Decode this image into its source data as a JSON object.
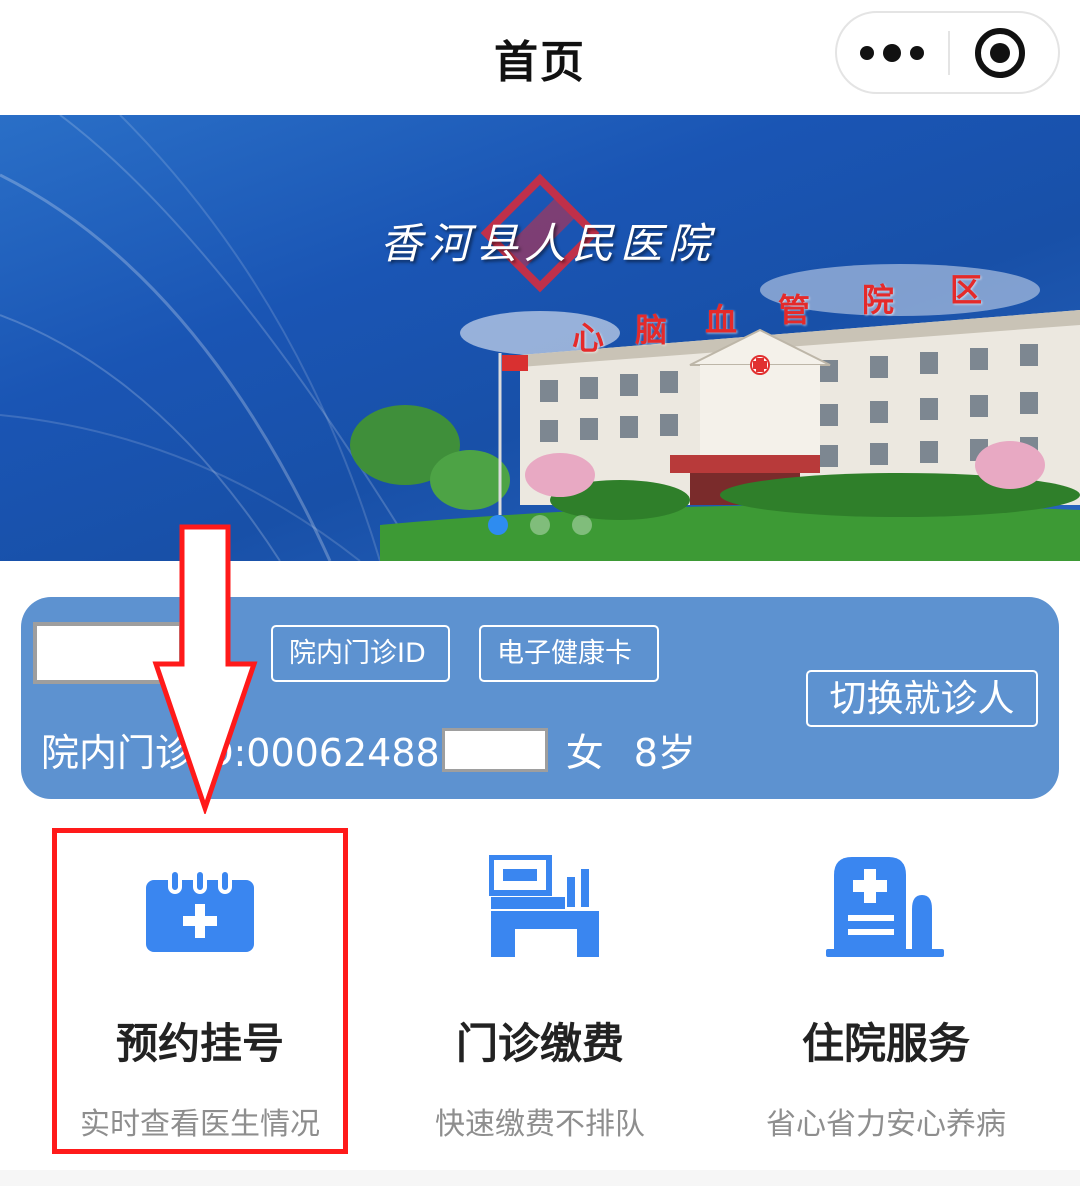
{
  "header": {
    "title": "首页",
    "more_icon": "more-dots-icon",
    "close_icon": "target-circle-icon"
  },
  "banner": {
    "hospital_name": "香河县人民医院",
    "building_sign": [
      "心",
      "脑",
      "血",
      "管",
      "院",
      "区"
    ],
    "carousel_count": 3,
    "active_index": 0
  },
  "patient_card": {
    "name": "",
    "outpatient_id_button": "院内门诊ID",
    "health_card_button": "电子健康卡",
    "switch_button": "切换就诊人",
    "id_line_prefix": "院内门诊ID:00062488",
    "sex": "女",
    "age": "8岁"
  },
  "services": [
    {
      "label": "预约挂号",
      "subtitle": "实时查看医生情况",
      "icon": "calendar-plus-icon"
    },
    {
      "label": "门诊缴费",
      "subtitle": "快速缴费不排队",
      "icon": "payment-terminal-icon"
    },
    {
      "label": "住院服务",
      "subtitle": "省心省力安心养病",
      "icon": "hospital-bed-icon"
    }
  ],
  "colors": {
    "accent_blue": "#3a86f0",
    "card_blue": "#5d92d0",
    "annotation_red": "#ff1a1a"
  }
}
